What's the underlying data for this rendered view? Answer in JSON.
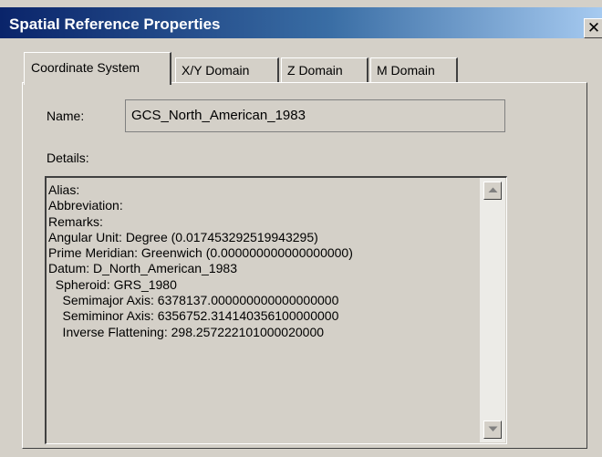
{
  "window": {
    "title": "Spatial Reference Properties",
    "close_glyph": "✕"
  },
  "tabs": [
    {
      "label": "Coordinate System",
      "active": true
    },
    {
      "label": "X/Y Domain",
      "active": false
    },
    {
      "label": "Z Domain",
      "active": false
    },
    {
      "label": "M Domain",
      "active": false
    }
  ],
  "name": {
    "label": "Name:",
    "value": "GCS_North_American_1983"
  },
  "details": {
    "label": "Details:",
    "lines": [
      "Alias:",
      "Abbreviation:",
      "Remarks:",
      "Angular Unit: Degree (0.017453292519943295)",
      "Prime Meridian: Greenwich (0.000000000000000000)",
      "Datum: D_North_American_1983",
      "  Spheroid: GRS_1980",
      "    Semimajor Axis: 6378137.000000000000000000",
      "    Semiminor Axis: 6356752.314140356100000000",
      "    Inverse Flattening: 298.257222101000020000"
    ]
  },
  "icons": {
    "scroll_up": "arrow-up-icon",
    "scroll_down": "arrow-down-icon",
    "close": "close-icon"
  }
}
